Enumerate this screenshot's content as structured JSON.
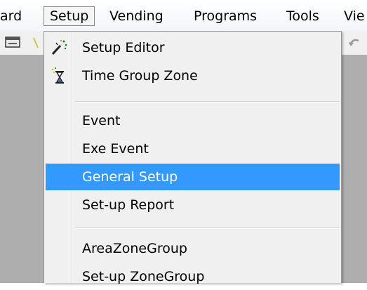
{
  "menubar": {
    "items": [
      {
        "label": "ard"
      },
      {
        "label": "Setup",
        "active": true
      },
      {
        "label": "Vending"
      },
      {
        "label": "Programs"
      },
      {
        "label": "Tools"
      },
      {
        "label": "Vie"
      }
    ]
  },
  "setup_menu": {
    "items": [
      {
        "label": "Setup Editor",
        "icon": "magic-wand-icon"
      },
      {
        "label": "Time Group Zone",
        "icon": "hourglass-icon"
      },
      {
        "label": "Event"
      },
      {
        "label": "Exe Event"
      },
      {
        "label": "General Setup",
        "highlighted": true
      },
      {
        "label": "Set-up Report"
      },
      {
        "label": "AreaZoneGroup"
      },
      {
        "label": "Set-up ZoneGroup"
      }
    ]
  },
  "colors": {
    "highlight": "#3399ff",
    "menu_background": "#f0f0f0",
    "app_background": "#aeaeae"
  }
}
